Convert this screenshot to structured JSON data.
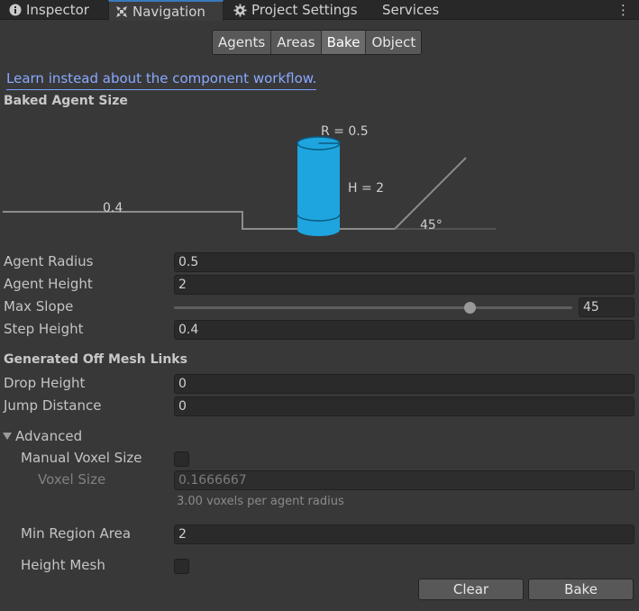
{
  "tabs": [
    {
      "label": "Inspector",
      "icon": "info-icon",
      "active": false
    },
    {
      "label": "Navigation",
      "icon": "navigation-icon",
      "active": true
    },
    {
      "label": "Project Settings",
      "icon": "gear-icon",
      "active": false
    },
    {
      "label": "Services",
      "icon": "",
      "active": false
    }
  ],
  "menu_glyph": "⋮",
  "segments": [
    {
      "label": "Agents",
      "active": false
    },
    {
      "label": "Areas",
      "active": false
    },
    {
      "label": "Bake",
      "active": true
    },
    {
      "label": "Object",
      "active": false
    }
  ],
  "link_text": "Learn instead about the component workflow.",
  "baked_agent_size": {
    "header": "Baked Agent Size",
    "diagram": {
      "radius_label": "R = 0.5",
      "height_label": "H = 2",
      "step_label": "0.4",
      "slope_label": "45°",
      "cylinder_color": "#1ea5df",
      "line_color": "#8c8c8c"
    },
    "agent_radius": {
      "label": "Agent Radius",
      "value": "0.5"
    },
    "agent_height": {
      "label": "Agent Height",
      "value": "2"
    },
    "max_slope": {
      "label": "Max Slope",
      "value": "45",
      "min": 0,
      "max": 60
    },
    "step_height": {
      "label": "Step Height",
      "value": "0.4"
    }
  },
  "off_mesh_links": {
    "header": "Generated Off Mesh Links",
    "drop_height": {
      "label": "Drop Height",
      "value": "0"
    },
    "jump_distance": {
      "label": "Jump Distance",
      "value": "0"
    }
  },
  "advanced": {
    "label": "Advanced",
    "expanded": true,
    "manual_voxel_size": {
      "label": "Manual Voxel Size",
      "checked": false
    },
    "voxel_size": {
      "label": "Voxel Size",
      "value": "0.1666667",
      "hint": "3.00 voxels per agent radius"
    },
    "min_region_area": {
      "label": "Min Region Area",
      "value": "2"
    },
    "height_mesh": {
      "label": "Height Mesh",
      "checked": false
    }
  },
  "buttons": {
    "clear": "Clear",
    "bake": "Bake"
  },
  "colors": {
    "accent": "#3a79bb",
    "link": "#8aa9ff",
    "background": "#383838"
  }
}
